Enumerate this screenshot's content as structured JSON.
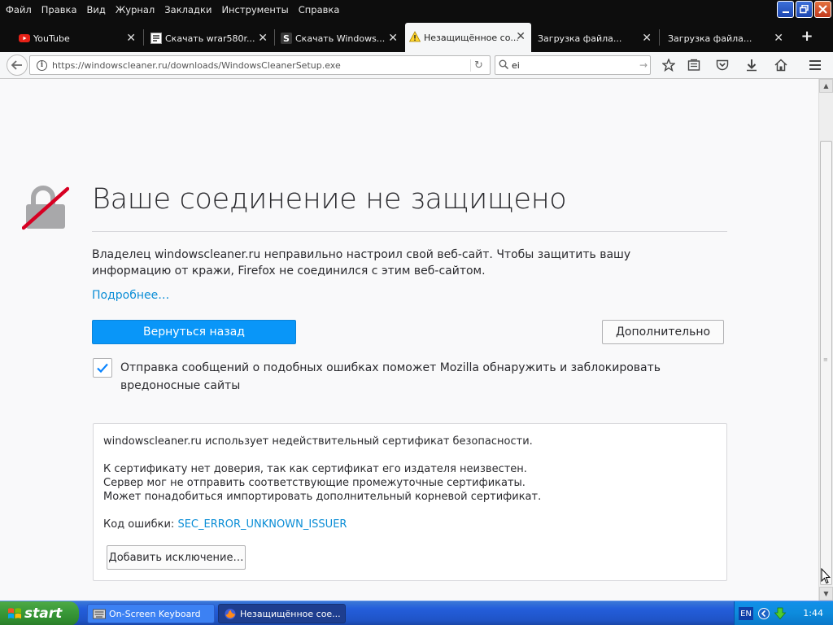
{
  "menubar": {
    "items": [
      "Файл",
      "Правка",
      "Вид",
      "Журнал",
      "Закладки",
      "Инструменты",
      "Справка"
    ]
  },
  "tabs": [
    {
      "title": "YouTube",
      "icon": "youtube-icon",
      "active": false
    },
    {
      "title": "Скачать wrar580r...",
      "icon": "page-icon",
      "active": false
    },
    {
      "title": "Скачать Windows...",
      "icon": "s-icon",
      "active": false
    },
    {
      "title": "Незащищённое со...",
      "icon": "warning-icon",
      "active": true
    },
    {
      "title": "Загрузка файла...",
      "icon": "",
      "active": false
    },
    {
      "title": "Загрузка файла...",
      "icon": "",
      "active": false
    }
  ],
  "navbar": {
    "url": "https://windowscleaner.ru/downloads/WindowsCleanerSetup.exe",
    "search_value": "ei"
  },
  "error_page": {
    "title": "Ваше соединение не защищено",
    "description": "Владелец windowscleaner.ru неправильно настроил свой веб-сайт. Чтобы защитить вашу информацию от кражи, Firefox не соединился с этим веб-сайтом.",
    "learn_more": "Подробнее…",
    "go_back_label": "Вернуться назад",
    "advanced_label": "Дополнительно",
    "report_checked": true,
    "report_text": "Отправка сообщений о подобных ошибках поможет Mozilla обнаружить и заблокировать вредоносные сайты",
    "details": {
      "line1": "windowscleaner.ru использует недействительный сертификат безопасности.",
      "line2": "К сертификату нет доверия, так как сертификат его издателя неизвестен.",
      "line3": "Сервер мог не отправить соответствующие промежуточные сертификаты.",
      "line4": "Может понадобиться импортировать дополнительный корневой сертификат.",
      "error_code_label": "Код ошибки:",
      "error_code": "SEC_ERROR_UNKNOWN_ISSUER",
      "add_exception_label": "Добавить исключение…"
    }
  },
  "taskbar": {
    "start_label": "start",
    "tasks": [
      {
        "label": "On-Screen Keyboard",
        "active": false
      },
      {
        "label": "Незащищённое сое...",
        "active": true
      }
    ],
    "tray_lang": "EN",
    "clock": "1:44"
  },
  "colors": {
    "accent_blue": "#0996f8",
    "link_blue": "#0a8dd6",
    "lock_strike": "#d70022",
    "taskbar_blue": "#245edb",
    "start_green": "#3a9a3a"
  }
}
